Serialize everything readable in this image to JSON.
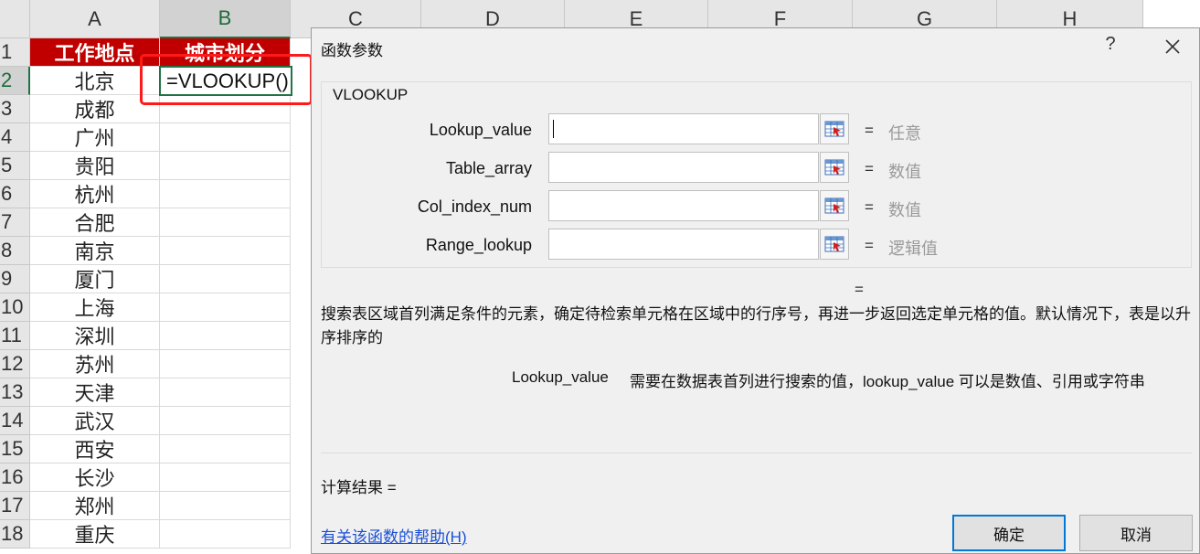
{
  "sheet": {
    "columns": [
      "A",
      "B",
      "C",
      "D",
      "E",
      "F",
      "G",
      "H"
    ],
    "rows": [
      "1",
      "2",
      "3",
      "4",
      "5",
      "6",
      "7",
      "8",
      "9",
      "10",
      "11",
      "12",
      "13",
      "14",
      "15",
      "16",
      "17",
      "18"
    ],
    "header": {
      "a1": "工作地点",
      "b1": "城市划分"
    },
    "cities": [
      "北京",
      "成都",
      "广州",
      "贵阳",
      "杭州",
      "合肥",
      "南京",
      "厦门",
      "上海",
      "深圳",
      "苏州",
      "天津",
      "武汉",
      "西安",
      "长沙",
      "郑州",
      "重庆"
    ],
    "formula": "=VLOOKUP()",
    "colors": {
      "header_fill": "#c00000",
      "selection": "#217346",
      "highlight_box": "#ff1a1a"
    }
  },
  "dialog": {
    "title": "函数参数",
    "help_glyph": "?",
    "function_name": "VLOOKUP",
    "args": [
      {
        "label": "Lookup_value",
        "equals": "=",
        "type": "任意"
      },
      {
        "label": "Table_array",
        "equals": "=",
        "type": "数值"
      },
      {
        "label": "Col_index_num",
        "equals": "=",
        "type": "数值"
      },
      {
        "label": "Range_lookup",
        "equals": "=",
        "type": "逻辑值"
      }
    ],
    "result_equals": "=",
    "description": "搜索表区域首列满足条件的元素，确定待检索单元格在区域中的行序号，再进一步返回选定单元格的值。默认情况下，表是以升序排序的",
    "arg_help_name": "Lookup_value",
    "arg_help_text": "需要在数据表首列进行搜索的值，lookup_value 可以是数值、引用或字符串",
    "calc_result": "计算结果 =",
    "help_link": "有关该函数的帮助(H)",
    "ok": "确定",
    "cancel": "取消"
  }
}
